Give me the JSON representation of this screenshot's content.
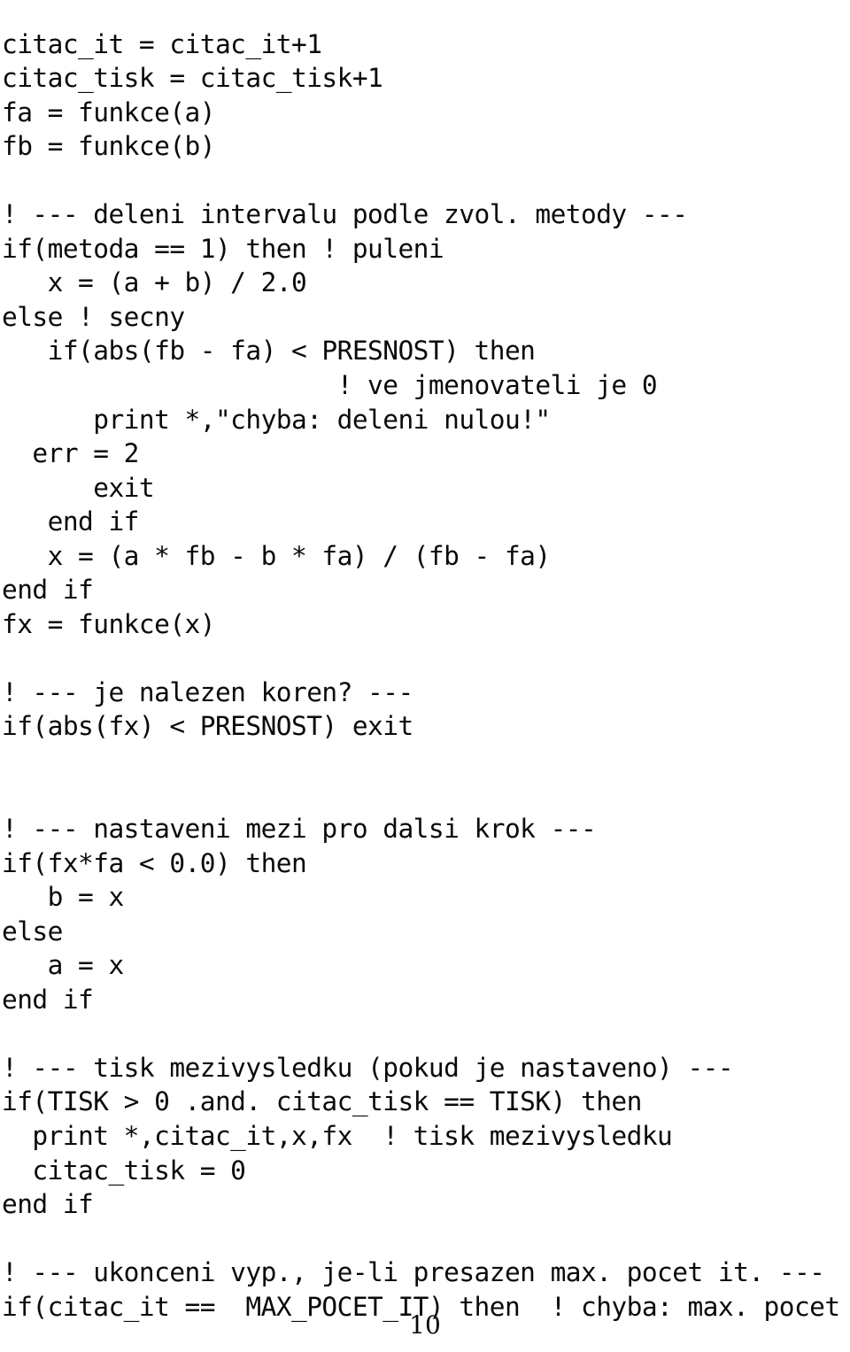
{
  "document": {
    "kind": "code-listing",
    "language_comment_marker": "!",
    "page_number": "10",
    "text_color": "#0a0a0a",
    "background_color": "#ffffff",
    "code_lines": [
      "citac_it = citac_it+1",
      "citac_tisk = citac_tisk+1",
      "fa = funkce(a)",
      "fb = funkce(b)",
      "",
      "! --- deleni intervalu podle zvol. metody ---",
      "if(metoda == 1) then ! puleni",
      "   x = (a + b) / 2.0",
      "else ! secny",
      "   if(abs(fb - fa) < PRESNOST) then",
      "                      ! ve jmenovateli je 0",
      "      print *,\"chyba: deleni nulou!\"",
      "  err = 2",
      "      exit",
      "   end if",
      "   x = (a * fb - b * fa) / (fb - fa)",
      "end if",
      "fx = funkce(x)",
      "",
      "! --- je nalezen koren? ---",
      "if(abs(fx) < PRESNOST) exit",
      "",
      "",
      "! --- nastaveni mezi pro dalsi krok ---",
      "if(fx*fa < 0.0) then",
      "   b = x",
      "else",
      "   a = x",
      "end if",
      "",
      "! --- tisk mezivysledku (pokud je nastaveno) ---",
      "if(TISK > 0 .and. citac_tisk == TISK) then",
      "  print *,citac_it,x,fx  ! tisk mezivysledku",
      "  citac_tisk = 0",
      "end if",
      "",
      "! --- ukonceni vyp., je-li presazen max. pocet it. ---",
      "if(citac_it ==  MAX_POCET_IT) then  ! chyba: max. pocet it."
    ]
  }
}
